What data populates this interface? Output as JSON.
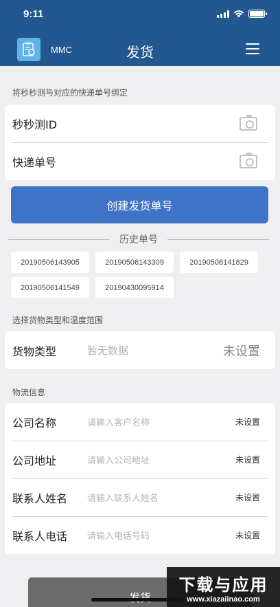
{
  "status_bar": {
    "time": "9:11"
  },
  "header": {
    "app_name": "MMC",
    "title": "发货",
    "menu_icon": "menu-icon",
    "logo_icon": "mmc-logo-icon"
  },
  "bind_section": {
    "label": "将秒秒测与对应的快递单号绑定",
    "rows": [
      {
        "label": "秒秒测ID",
        "icon": "camera-icon"
      },
      {
        "label": "快递单号",
        "icon": "camera-icon"
      }
    ]
  },
  "create_button": "创建发货单号",
  "history": {
    "title": "历史单号",
    "items": [
      "20190506143905",
      "20190506143309",
      "20190506141829",
      "20190506141549",
      "20190430095914"
    ]
  },
  "goods_section": {
    "label": "选择货物类型和温度范围",
    "row": {
      "label": "货物类型",
      "placeholder": "暂无数据",
      "value": "未设置"
    }
  },
  "logistics_section": {
    "label": "物流信息",
    "rows": [
      {
        "label": "公司名称",
        "placeholder": "请输入客户名称",
        "value": "未设置"
      },
      {
        "label": "公司地址",
        "placeholder": "请输入公司地址",
        "value": "未设置"
      },
      {
        "label": "联系人姓名",
        "placeholder": "请输入联系人姓名",
        "value": "未设置"
      },
      {
        "label": "联系人电话",
        "placeholder": "请输入电话号码",
        "value": "未设置"
      }
    ]
  },
  "submit_button": "发货",
  "watermark": {
    "main": "下载与应用",
    "sub": "www.xiazaiinao.com"
  },
  "colors": {
    "header": "#23578f",
    "primary": "#3f73c8",
    "background": "#efeff1"
  }
}
